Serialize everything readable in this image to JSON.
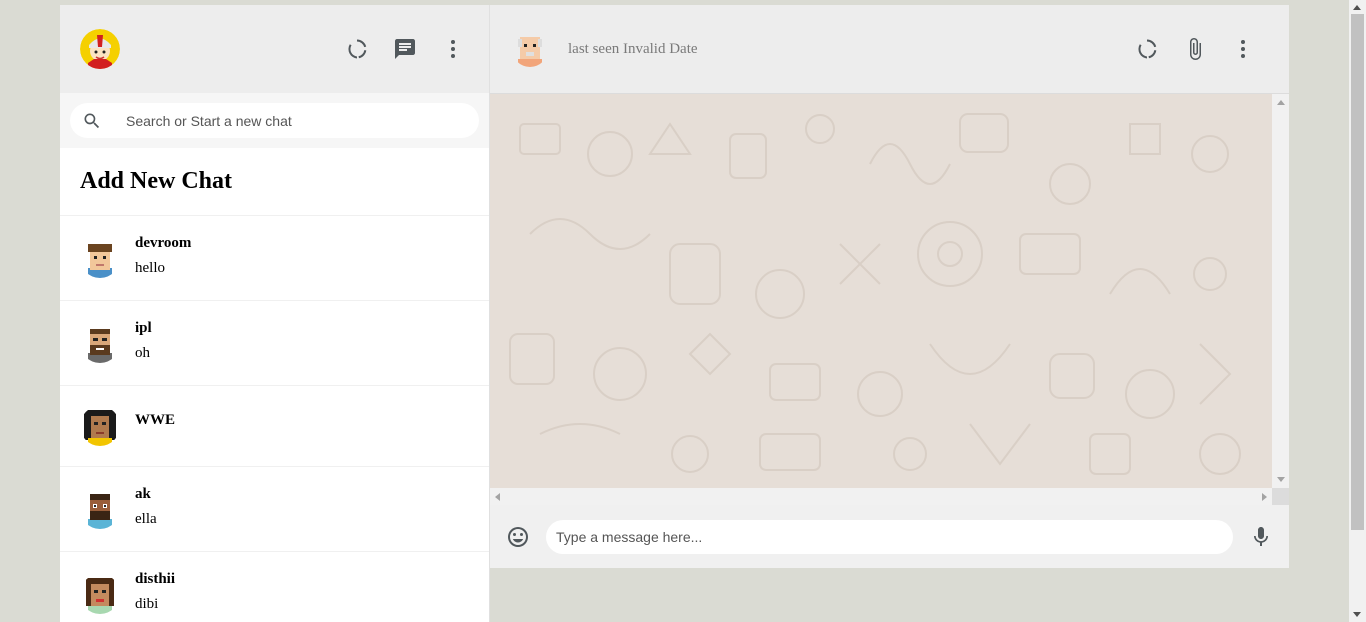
{
  "sidebar": {
    "search": {
      "placeholder": "Search or Start a new chat"
    },
    "add_new_chat_label": "Add New Chat",
    "chats": [
      {
        "name": "devroom",
        "last_message": "hello"
      },
      {
        "name": "ipl",
        "last_message": "oh"
      },
      {
        "name": "WWE",
        "last_message": ""
      },
      {
        "name": "ak",
        "last_message": "ella"
      },
      {
        "name": "disthii",
        "last_message": "dibi"
      }
    ]
  },
  "chat": {
    "status": "last seen Invalid Date",
    "input": {
      "placeholder": "Type a message here..."
    }
  },
  "icons": {
    "sidebar_header": [
      "status-icon",
      "chat-icon",
      "more-vert-icon"
    ],
    "chat_header": [
      "search-icon",
      "attach-icon",
      "more-vert-icon"
    ],
    "footer": [
      "emoji-icon",
      "mic-icon"
    ]
  },
  "colors": {
    "page_background": "#dadbd3",
    "header_background": "#ededed",
    "chat_background": "#e5ddd5",
    "footer_background": "#f0f0f0"
  }
}
